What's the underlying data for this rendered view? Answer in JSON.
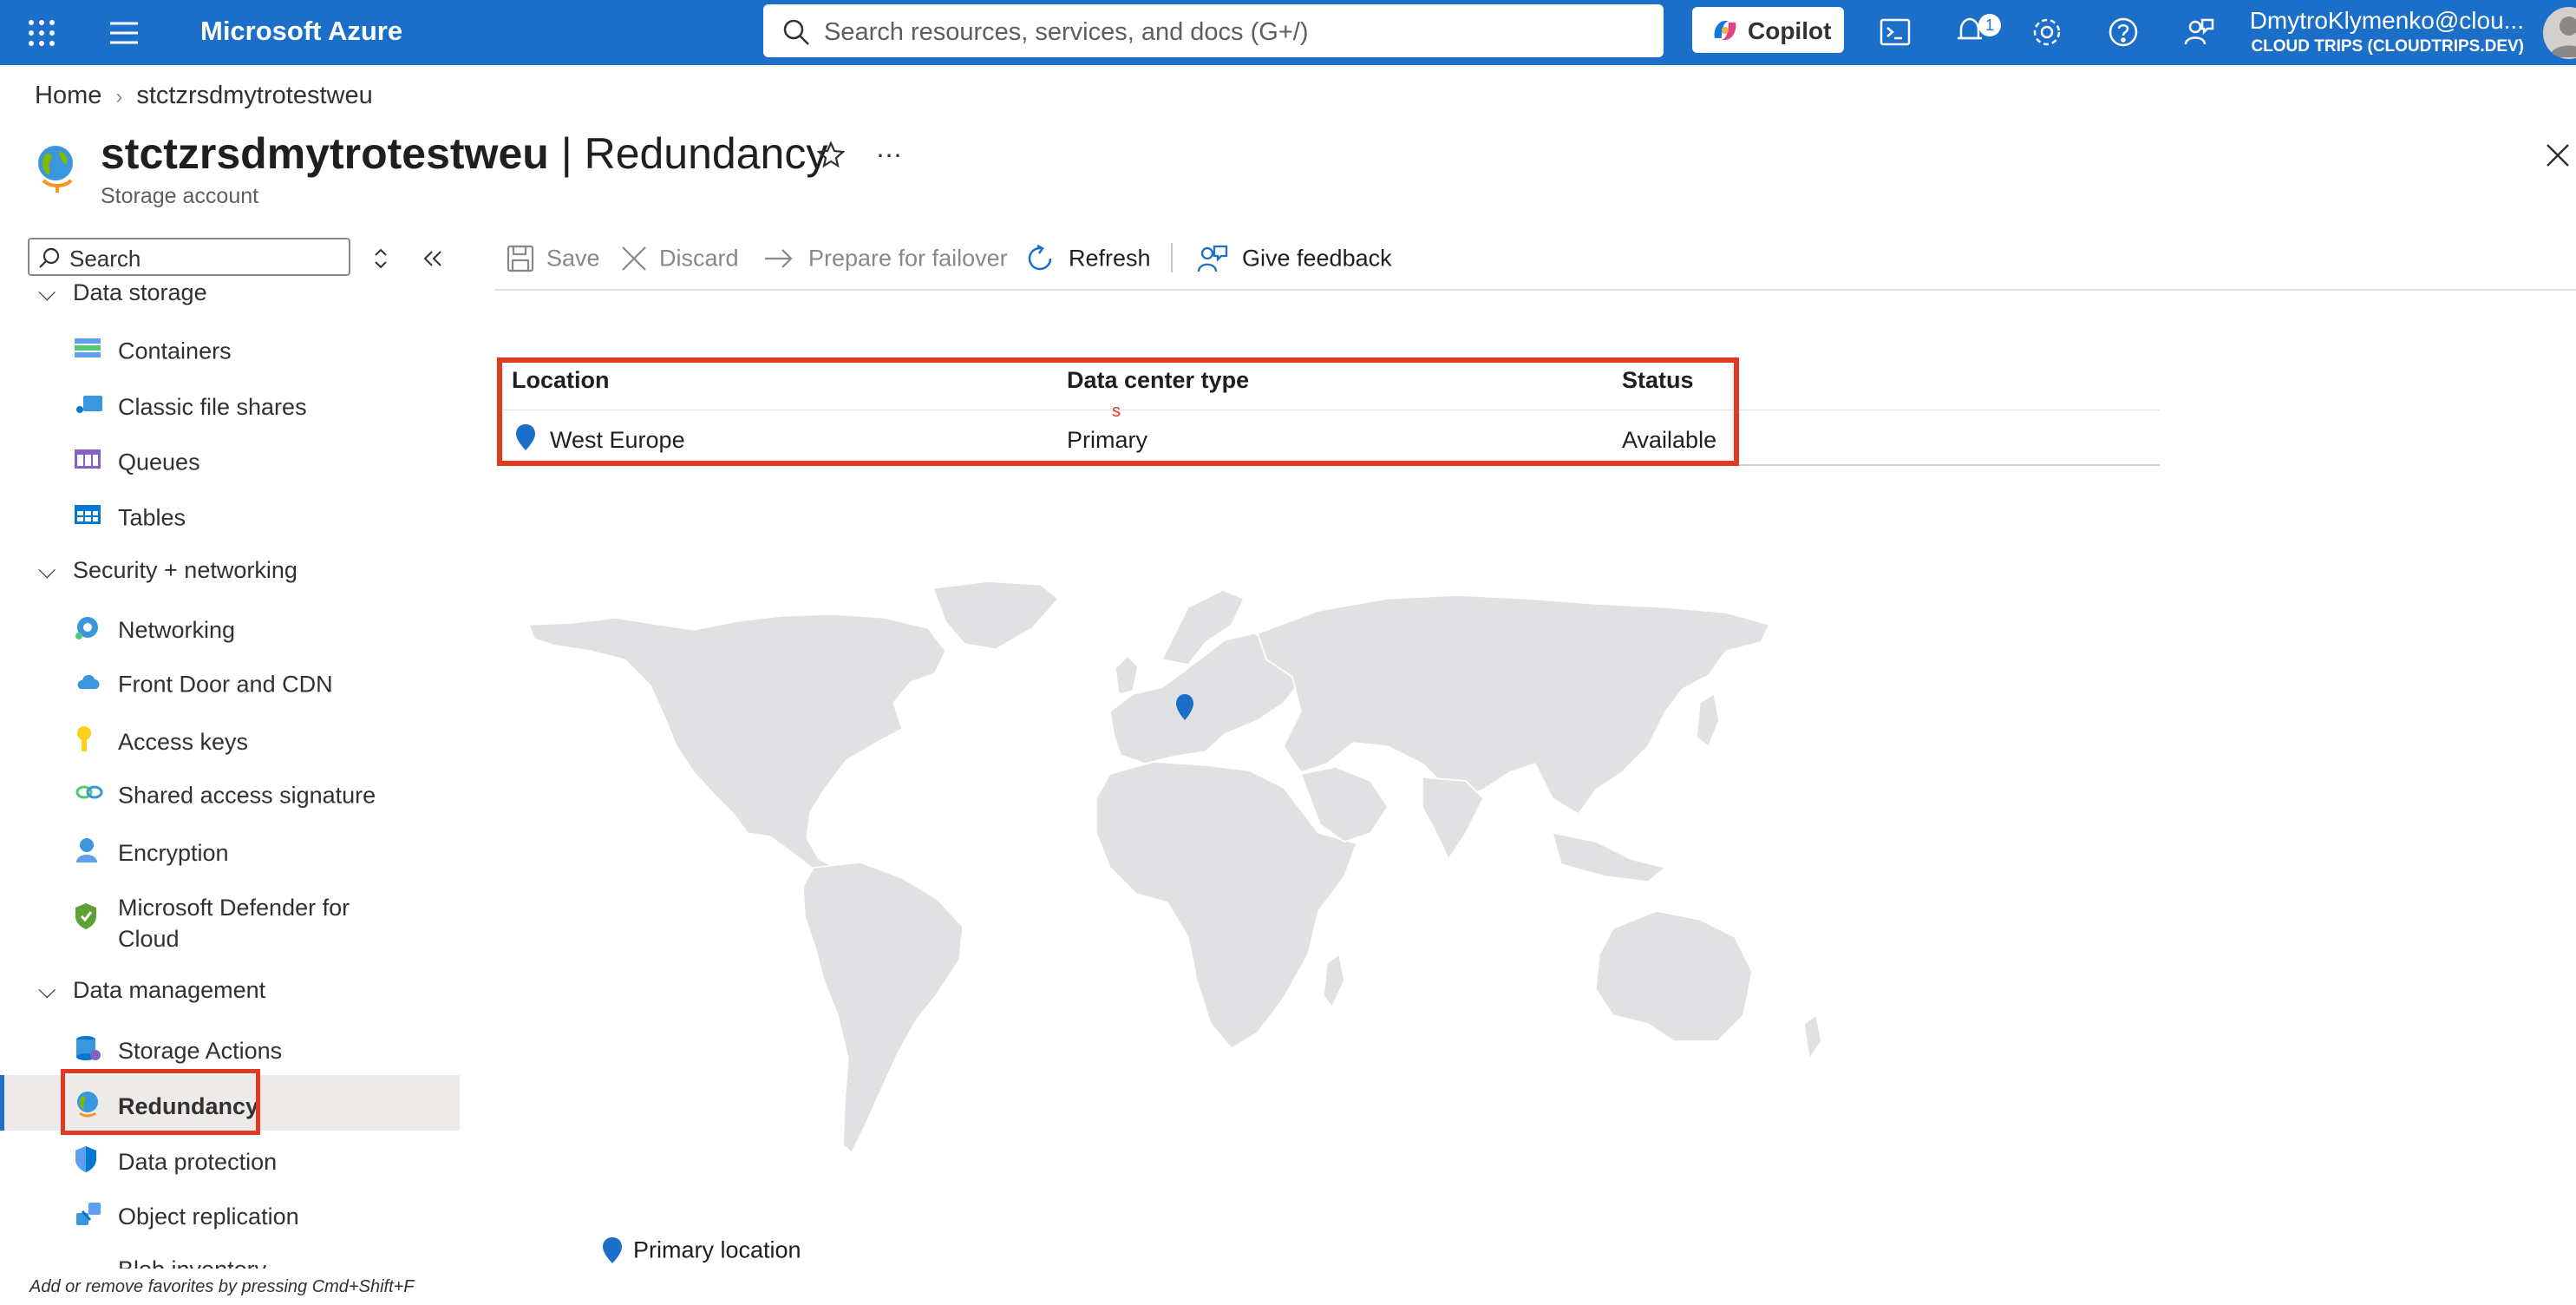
{
  "topbar": {
    "brand": "Microsoft Azure",
    "search_placeholder": "Search resources, services, and docs (G+/)",
    "copilot_label": "Copilot",
    "notification_count": "1",
    "user_name": "DmytroKlymenko@clou...",
    "user_directory": "CLOUD TRIPS (CLOUDTRIPS.DEV)",
    "accent_color": "#1b6fc9"
  },
  "breadcrumb": {
    "home": "Home",
    "current": "stctzrsdmytrotestweu"
  },
  "header": {
    "resource_name": "stctzrsdmytrotestweu",
    "blade": "| Redundancy",
    "subtitle": "Storage account"
  },
  "sidebar": {
    "search_placeholder": "Search",
    "groups": {
      "data_storage": "Data storage",
      "security": "Security + networking",
      "data_management": "Data management"
    },
    "items": {
      "containers": "Containers",
      "classic_file_shares": "Classic file shares",
      "queues": "Queues",
      "tables": "Tables",
      "networking": "Networking",
      "front_door": "Front Door and CDN",
      "access_keys": "Access keys",
      "sas": "Shared access signature",
      "encryption": "Encryption",
      "defender_1": "Microsoft Defender for",
      "defender_2": "Cloud",
      "storage_actions": "Storage Actions",
      "redundancy": "Redundancy",
      "data_protection": "Data protection",
      "object_replication": "Object replication",
      "blob_inventory": "Blob inventory"
    },
    "hint": "Add or remove favorites by pressing Cmd+Shift+F"
  },
  "toolbar": {
    "save": "Save",
    "discard": "Discard",
    "prepare_failover": "Prepare for failover",
    "refresh": "Refresh",
    "feedback": "Give feedback"
  },
  "table": {
    "columns": [
      "Location",
      "Data center type",
      "Status"
    ],
    "rows": [
      {
        "location": "West Europe",
        "type": "Primary",
        "status": "Available"
      }
    ],
    "stray_mark": "s"
  },
  "map": {
    "legend": "Primary location",
    "pin_color": "#1b6fc9",
    "land_color": "#e1e1e3"
  }
}
